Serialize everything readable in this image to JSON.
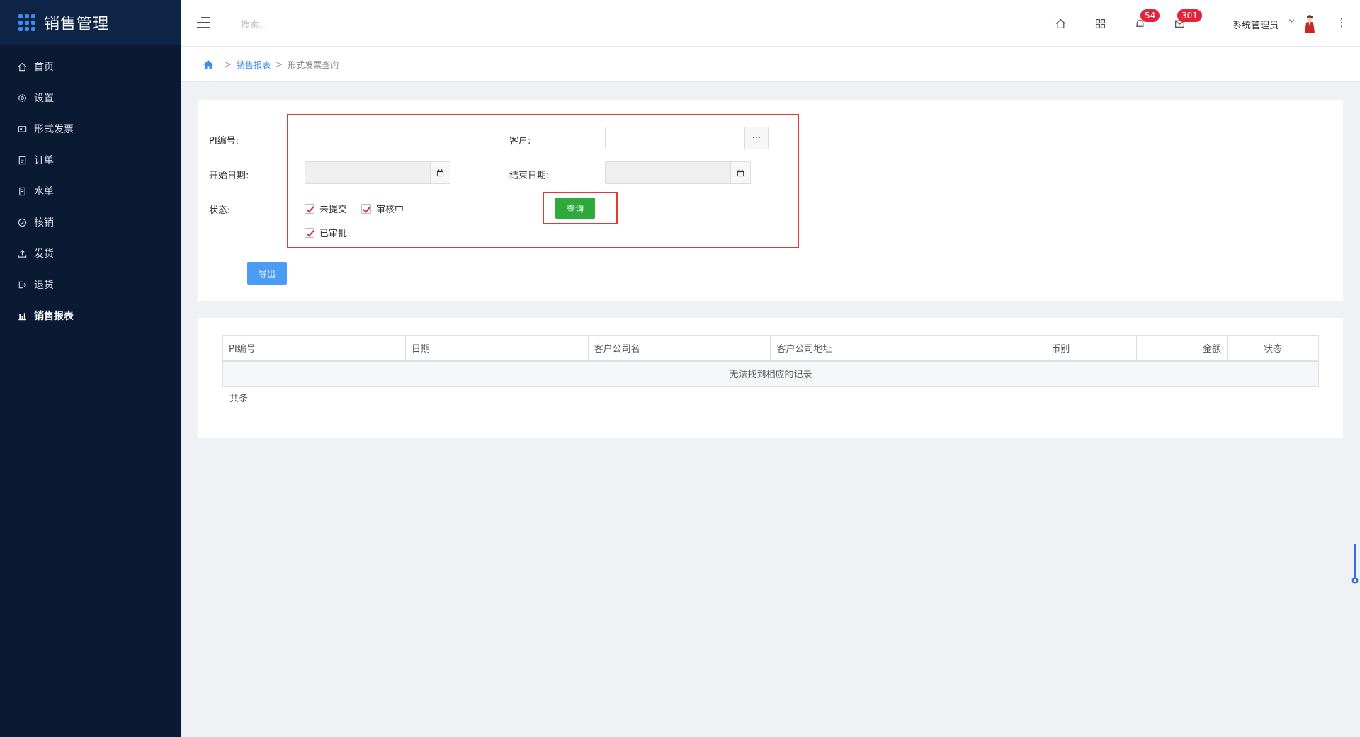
{
  "app": {
    "title": "销售管理",
    "accent": "#3d8cf0"
  },
  "sidebar": {
    "items": [
      {
        "label": "首页",
        "icon": "home-icon"
      },
      {
        "label": "设置",
        "icon": "gear-icon"
      },
      {
        "label": "形式发票",
        "icon": "invoice-icon"
      },
      {
        "label": "订单",
        "icon": "order-icon"
      },
      {
        "label": "水单",
        "icon": "receipt-icon"
      },
      {
        "label": "核销",
        "icon": "check-circle-icon"
      },
      {
        "label": "发货",
        "icon": "upload-icon"
      },
      {
        "label": "退货",
        "icon": "return-icon"
      },
      {
        "label": "销售报表",
        "icon": "bar-chart-icon",
        "active": true
      }
    ]
  },
  "header": {
    "search_placeholder": "搜索...",
    "notifications_count": "54",
    "messages_count": "301",
    "user_name": "系统管理员"
  },
  "breadcrumb": {
    "parent": "销售报表",
    "current": "形式发票查询",
    "separator": ">"
  },
  "filter": {
    "pi_label": "PI编号:",
    "customer_label": "客户:",
    "start_label": "开始日期:",
    "end_label": "结束日期:",
    "status_label": "状态:",
    "status_options": [
      {
        "label": "未提交",
        "checked": true
      },
      {
        "label": "审核中",
        "checked": true
      },
      {
        "label": "已审批",
        "checked": true
      }
    ],
    "query_button": "查询",
    "export_button": "导出",
    "customer_picker": "···"
  },
  "table": {
    "columns": [
      "PI编号",
      "日期",
      "客户公司名",
      "客户公司地址",
      "币别",
      "金额",
      "状态"
    ],
    "empty_text": "无法找到相应的记录",
    "footer": "共条"
  }
}
